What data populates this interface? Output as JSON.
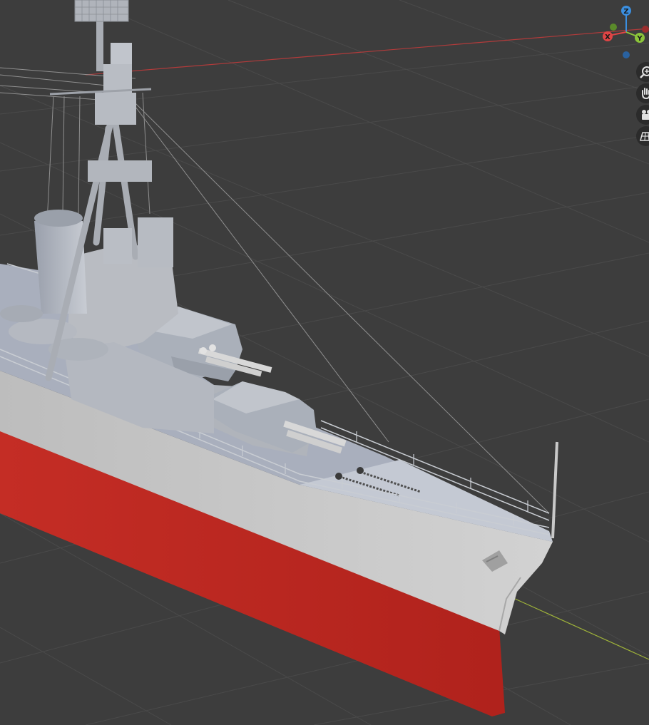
{
  "viewport": {
    "background_color": "#3d3d3d",
    "grid_color": "#4b4b4b",
    "x_axis_color": "#b23b3b",
    "y_axis_color": "#9fb33a"
  },
  "gizmo": {
    "z_label": "Z",
    "y_label": "Y",
    "x_label": "X",
    "x_color": "#e04545",
    "y_color": "#8bc43a",
    "z_color": "#3b8fe0"
  },
  "nav_controls": [
    {
      "icon": "zoom-icon"
    },
    {
      "icon": "hand-pan-icon"
    },
    {
      "icon": "camera-icon"
    },
    {
      "icon": "grid-perspective-icon"
    }
  ],
  "model": {
    "hull_color": "#c9c9c9",
    "hull_bottom_color": "#b82a22",
    "deck_color": "#a9afbd",
    "superstructure_color": "#b9bcc2"
  }
}
